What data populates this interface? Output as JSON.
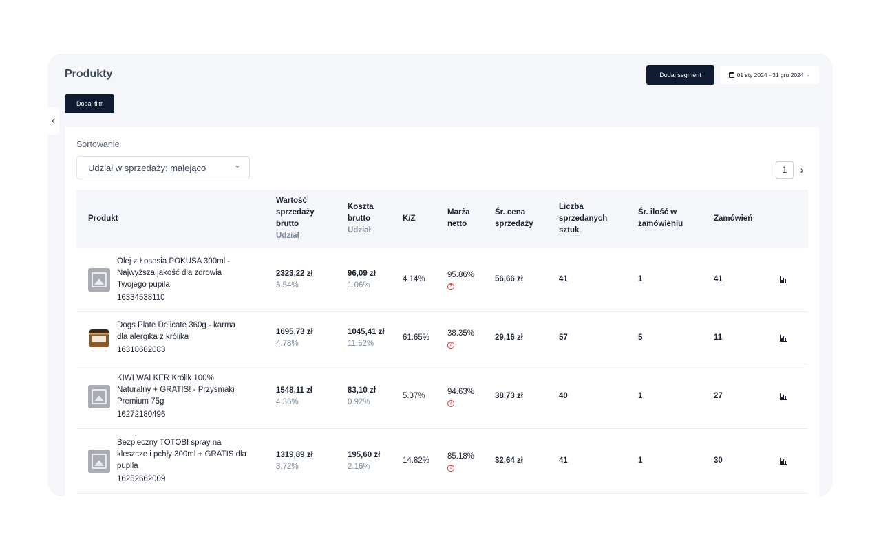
{
  "header": {
    "title": "Produkty",
    "add_filter_label": "Dodaj filtr",
    "add_segment_label": "Dodaj segment",
    "date_range": "01 sty 2024 - 31 gru 2024"
  },
  "sort": {
    "label": "Sortowanie",
    "selected": "Udział w sprzedaży: malejąco"
  },
  "pagination": {
    "current_page": "1"
  },
  "table": {
    "columns": {
      "product": "Produkt",
      "sales_value_l1": "Wartość",
      "sales_value_l2": "sprzedaży",
      "sales_value_l3": "brutto",
      "sales_value_sub": "Udział",
      "cost_l1": "Koszta",
      "cost_l2": "brutto",
      "cost_sub": "Udział",
      "kz": "K/Z",
      "margin_l1": "Marża",
      "margin_l2": "netto",
      "avg_price_l1": "Śr. cena",
      "avg_price_l2": "sprzedaży",
      "units_l1": "Liczba",
      "units_l2": "sprzedanych",
      "units_l3": "sztuk",
      "avg_qty_l1": "Śr. ilość w",
      "avg_qty_l2": "zamówieniu",
      "orders": "Zamówień"
    },
    "rows": [
      {
        "name_lines": [
          "Olej z Łososia POKUSA 300ml -",
          "Najwyższa jakość dla zdrowia",
          "Twojego pupila"
        ],
        "id": "16334538110",
        "sales_value": "2323,22 zł",
        "sales_share": "6.54%",
        "cost": "96,09 zł",
        "cost_share": "1.06%",
        "kz": "4.14%",
        "margin": "95.86%",
        "avg_price": "56,66 zł",
        "units": "41",
        "avg_qty": "1",
        "orders": "41"
      },
      {
        "name_lines": [
          "Dogs Plate Delicate 360g - karma",
          "dla alergika z królika"
        ],
        "id": "16318682083",
        "sales_value": "1695,73 zł",
        "sales_share": "4.78%",
        "cost": "1045,41 zł",
        "cost_share": "11.52%",
        "kz": "61.65%",
        "margin": "38.35%",
        "avg_price": "29,16 zł",
        "units": "57",
        "avg_qty": "5",
        "orders": "11"
      },
      {
        "name_lines": [
          "KIWI WALKER Królik 100%",
          "Naturalny + GRATIS! - Przysmaki",
          "Premium 75g"
        ],
        "id": "16272180496",
        "sales_value": "1548,11 zł",
        "sales_share": "4.36%",
        "cost": "83,10 zł",
        "cost_share": "0.92%",
        "kz": "5.37%",
        "margin": "94.63%",
        "avg_price": "38,73 zł",
        "units": "40",
        "avg_qty": "1",
        "orders": "27"
      },
      {
        "name_lines": [
          "Bezpieczny TOTOBI spray na",
          "kleszcze i pchły 300ml + GRATIS dla",
          "pupila"
        ],
        "id": "16252662009",
        "sales_value": "1319,89 zł",
        "sales_share": "3.72%",
        "cost": "195,60 zł",
        "cost_share": "2.16%",
        "kz": "14.82%",
        "margin": "85.18%",
        "avg_price": "32,64 zł",
        "units": "41",
        "avg_qty": "1",
        "orders": "30"
      }
    ]
  }
}
